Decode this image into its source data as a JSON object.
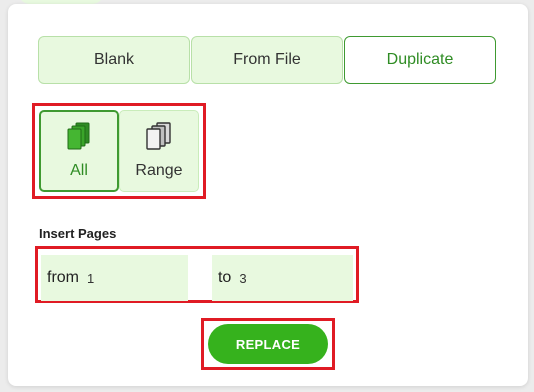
{
  "tabs": [
    {
      "label": "Blank",
      "active": false
    },
    {
      "label": "From File",
      "active": false
    },
    {
      "label": "Duplicate",
      "active": true
    }
  ],
  "modes": [
    {
      "label": "All",
      "icon": "pages-stack-filled-icon",
      "active": true
    },
    {
      "label": "Range",
      "icon": "pages-stack-outline-icon",
      "active": false
    }
  ],
  "insert_pages": {
    "label": "Insert Pages",
    "from_label": "from",
    "from_value": "1",
    "to_label": "to",
    "to_value": "3"
  },
  "actions": {
    "replace_label": "REPLACE"
  },
  "colors": {
    "accent": "#36b21d",
    "accent_dark": "#2f8c24",
    "tab_bg": "#e8f9df",
    "highlight": "#e01b24"
  }
}
